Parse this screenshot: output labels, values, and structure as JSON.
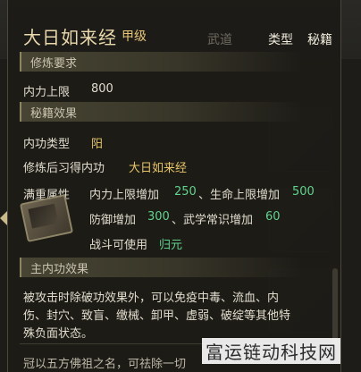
{
  "header": {
    "title": "大日如来经",
    "grade": "甲级",
    "tabs": [
      "武道",
      "类型",
      "秘籍"
    ]
  },
  "cultivation_requirement": {
    "section_label": "修炼要求",
    "row_label": "内力上限",
    "row_value": "800"
  },
  "book_effect": {
    "section_label": "秘籍效果",
    "type_label": "内功类型",
    "type_value": "阳",
    "learnable_label": "修炼后习得内功",
    "learnable_value": "大日如来经",
    "full_level_label": "满重属性",
    "attr_line1_a_label": "内力上限增加",
    "attr_line1_a_value": "250",
    "attr_line1_b_label": "生命上限增加",
    "attr_line1_b_value": "500",
    "attr_line2_a_label": "防御增加",
    "attr_line2_a_value": "300",
    "attr_line2_b_label": "武学常识增加",
    "attr_line2_b_value": "60",
    "combat_label": "战斗可使用",
    "combat_value": "归元"
  },
  "main_internal_effect": {
    "section_label": "主内功效果",
    "desc_line1": "被攻击时除破功效果外，可以免疫中毒、流血、内",
    "desc_line2": "伤、封穴、致盲、缴械、卸甲、虚弱、破绽等其他特",
    "desc_line3": "殊负面状态。",
    "desc_next": "冠以五方佛祖之名，可祛除一切"
  },
  "watermark": "富运链动科技网",
  "colors": {
    "accent_gold": "#e6c46a",
    "accent_green": "#62d38e",
    "text_main": "#e1dccd"
  }
}
